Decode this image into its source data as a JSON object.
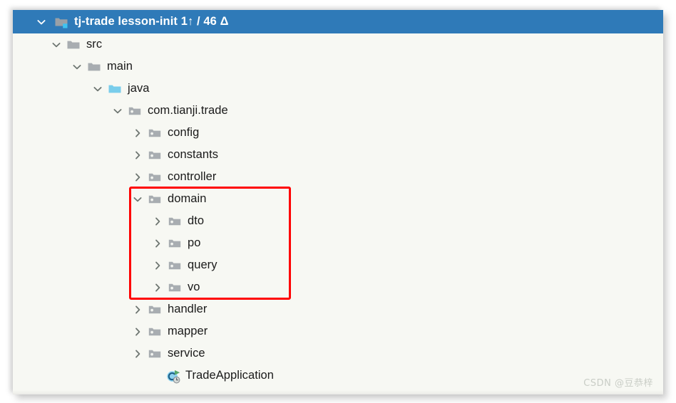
{
  "window": {
    "header": {
      "title": "tj-trade  lesson-init 1↑ / 46 Δ",
      "module_name": "tj-trade",
      "branch": "lesson-init",
      "ahead_count": "1↑",
      "changes_count": "46 Δ",
      "expand_state": "expanded",
      "background_color": "#2f7ab8",
      "text_color": "#ffffff"
    },
    "background_color": "#f7f8f3",
    "text_color": "#1a1a1a"
  },
  "highlight": {
    "color": "#ff0000",
    "target": "domain",
    "note": "red rectangle around domain package and its children"
  },
  "watermark": {
    "text": "CSDN @豆恭梓"
  },
  "tree": {
    "nodes": [
      {
        "label": "src",
        "depth": 1,
        "icon": "folder-gray",
        "chevron": "expanded",
        "indent": 75
      },
      {
        "label": "main",
        "depth": 2,
        "icon": "folder-gray",
        "chevron": "expanded",
        "indent": 104
      },
      {
        "label": "java",
        "depth": 3,
        "icon": "folder-blue",
        "chevron": "expanded",
        "indent": 133
      },
      {
        "label": "com.tianji.trade",
        "depth": 4,
        "icon": "package-gray",
        "chevron": "expanded",
        "indent": 161
      },
      {
        "label": "config",
        "depth": 5,
        "icon": "package-gray",
        "chevron": "collapsed",
        "indent": 189
      },
      {
        "label": "constants",
        "depth": 5,
        "icon": "package-gray",
        "chevron": "collapsed",
        "indent": 189
      },
      {
        "label": "controller",
        "depth": 5,
        "icon": "package-gray",
        "chevron": "collapsed",
        "indent": 189
      },
      {
        "label": "domain",
        "depth": 5,
        "icon": "package-gray",
        "chevron": "expanded",
        "indent": 189
      },
      {
        "label": "dto",
        "depth": 6,
        "icon": "package-gray",
        "chevron": "collapsed",
        "indent": 217
      },
      {
        "label": "po",
        "depth": 6,
        "icon": "package-gray",
        "chevron": "collapsed",
        "indent": 217
      },
      {
        "label": "query",
        "depth": 6,
        "icon": "package-gray",
        "chevron": "collapsed",
        "indent": 217
      },
      {
        "label": "vo",
        "depth": 6,
        "icon": "package-gray",
        "chevron": "collapsed",
        "indent": 217
      },
      {
        "label": "handler",
        "depth": 5,
        "icon": "package-gray",
        "chevron": "collapsed",
        "indent": 189
      },
      {
        "label": "mapper",
        "depth": 5,
        "icon": "package-gray",
        "chevron": "collapsed",
        "indent": 189
      },
      {
        "label": "service",
        "depth": 5,
        "icon": "package-gray",
        "chevron": "collapsed",
        "indent": 189
      },
      {
        "label": "TradeApplication",
        "depth": 5,
        "icon": "java-class-runnable",
        "chevron": "none",
        "indent": 214
      }
    ]
  }
}
